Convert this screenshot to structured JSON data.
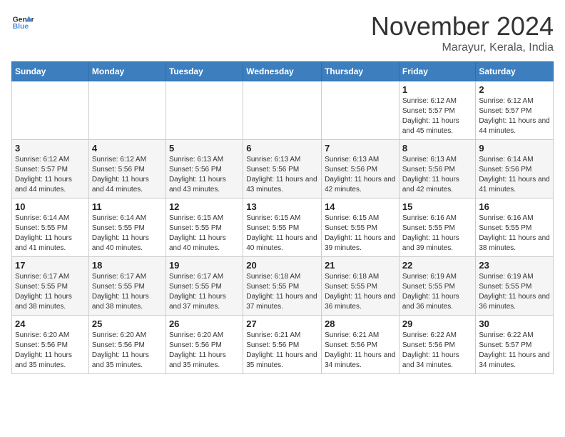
{
  "header": {
    "logo_general": "General",
    "logo_blue": "Blue",
    "month_title": "November 2024",
    "location": "Marayur, Kerala, India"
  },
  "weekdays": [
    "Sunday",
    "Monday",
    "Tuesday",
    "Wednesday",
    "Thursday",
    "Friday",
    "Saturday"
  ],
  "weeks": [
    [
      {
        "day": "",
        "info": ""
      },
      {
        "day": "",
        "info": ""
      },
      {
        "day": "",
        "info": ""
      },
      {
        "day": "",
        "info": ""
      },
      {
        "day": "",
        "info": ""
      },
      {
        "day": "1",
        "info": "Sunrise: 6:12 AM\nSunset: 5:57 PM\nDaylight: 11 hours and 45 minutes."
      },
      {
        "day": "2",
        "info": "Sunrise: 6:12 AM\nSunset: 5:57 PM\nDaylight: 11 hours and 44 minutes."
      }
    ],
    [
      {
        "day": "3",
        "info": "Sunrise: 6:12 AM\nSunset: 5:57 PM\nDaylight: 11 hours and 44 minutes."
      },
      {
        "day": "4",
        "info": "Sunrise: 6:12 AM\nSunset: 5:56 PM\nDaylight: 11 hours and 44 minutes."
      },
      {
        "day": "5",
        "info": "Sunrise: 6:13 AM\nSunset: 5:56 PM\nDaylight: 11 hours and 43 minutes."
      },
      {
        "day": "6",
        "info": "Sunrise: 6:13 AM\nSunset: 5:56 PM\nDaylight: 11 hours and 43 minutes."
      },
      {
        "day": "7",
        "info": "Sunrise: 6:13 AM\nSunset: 5:56 PM\nDaylight: 11 hours and 42 minutes."
      },
      {
        "day": "8",
        "info": "Sunrise: 6:13 AM\nSunset: 5:56 PM\nDaylight: 11 hours and 42 minutes."
      },
      {
        "day": "9",
        "info": "Sunrise: 6:14 AM\nSunset: 5:56 PM\nDaylight: 11 hours and 41 minutes."
      }
    ],
    [
      {
        "day": "10",
        "info": "Sunrise: 6:14 AM\nSunset: 5:55 PM\nDaylight: 11 hours and 41 minutes."
      },
      {
        "day": "11",
        "info": "Sunrise: 6:14 AM\nSunset: 5:55 PM\nDaylight: 11 hours and 40 minutes."
      },
      {
        "day": "12",
        "info": "Sunrise: 6:15 AM\nSunset: 5:55 PM\nDaylight: 11 hours and 40 minutes."
      },
      {
        "day": "13",
        "info": "Sunrise: 6:15 AM\nSunset: 5:55 PM\nDaylight: 11 hours and 40 minutes."
      },
      {
        "day": "14",
        "info": "Sunrise: 6:15 AM\nSunset: 5:55 PM\nDaylight: 11 hours and 39 minutes."
      },
      {
        "day": "15",
        "info": "Sunrise: 6:16 AM\nSunset: 5:55 PM\nDaylight: 11 hours and 39 minutes."
      },
      {
        "day": "16",
        "info": "Sunrise: 6:16 AM\nSunset: 5:55 PM\nDaylight: 11 hours and 38 minutes."
      }
    ],
    [
      {
        "day": "17",
        "info": "Sunrise: 6:17 AM\nSunset: 5:55 PM\nDaylight: 11 hours and 38 minutes."
      },
      {
        "day": "18",
        "info": "Sunrise: 6:17 AM\nSunset: 5:55 PM\nDaylight: 11 hours and 38 minutes."
      },
      {
        "day": "19",
        "info": "Sunrise: 6:17 AM\nSunset: 5:55 PM\nDaylight: 11 hours and 37 minutes."
      },
      {
        "day": "20",
        "info": "Sunrise: 6:18 AM\nSunset: 5:55 PM\nDaylight: 11 hours and 37 minutes."
      },
      {
        "day": "21",
        "info": "Sunrise: 6:18 AM\nSunset: 5:55 PM\nDaylight: 11 hours and 36 minutes."
      },
      {
        "day": "22",
        "info": "Sunrise: 6:19 AM\nSunset: 5:55 PM\nDaylight: 11 hours and 36 minutes."
      },
      {
        "day": "23",
        "info": "Sunrise: 6:19 AM\nSunset: 5:55 PM\nDaylight: 11 hours and 36 minutes."
      }
    ],
    [
      {
        "day": "24",
        "info": "Sunrise: 6:20 AM\nSunset: 5:56 PM\nDaylight: 11 hours and 35 minutes."
      },
      {
        "day": "25",
        "info": "Sunrise: 6:20 AM\nSunset: 5:56 PM\nDaylight: 11 hours and 35 minutes."
      },
      {
        "day": "26",
        "info": "Sunrise: 6:20 AM\nSunset: 5:56 PM\nDaylight: 11 hours and 35 minutes."
      },
      {
        "day": "27",
        "info": "Sunrise: 6:21 AM\nSunset: 5:56 PM\nDaylight: 11 hours and 35 minutes."
      },
      {
        "day": "28",
        "info": "Sunrise: 6:21 AM\nSunset: 5:56 PM\nDaylight: 11 hours and 34 minutes."
      },
      {
        "day": "29",
        "info": "Sunrise: 6:22 AM\nSunset: 5:56 PM\nDaylight: 11 hours and 34 minutes."
      },
      {
        "day": "30",
        "info": "Sunrise: 6:22 AM\nSunset: 5:57 PM\nDaylight: 11 hours and 34 minutes."
      }
    ]
  ]
}
